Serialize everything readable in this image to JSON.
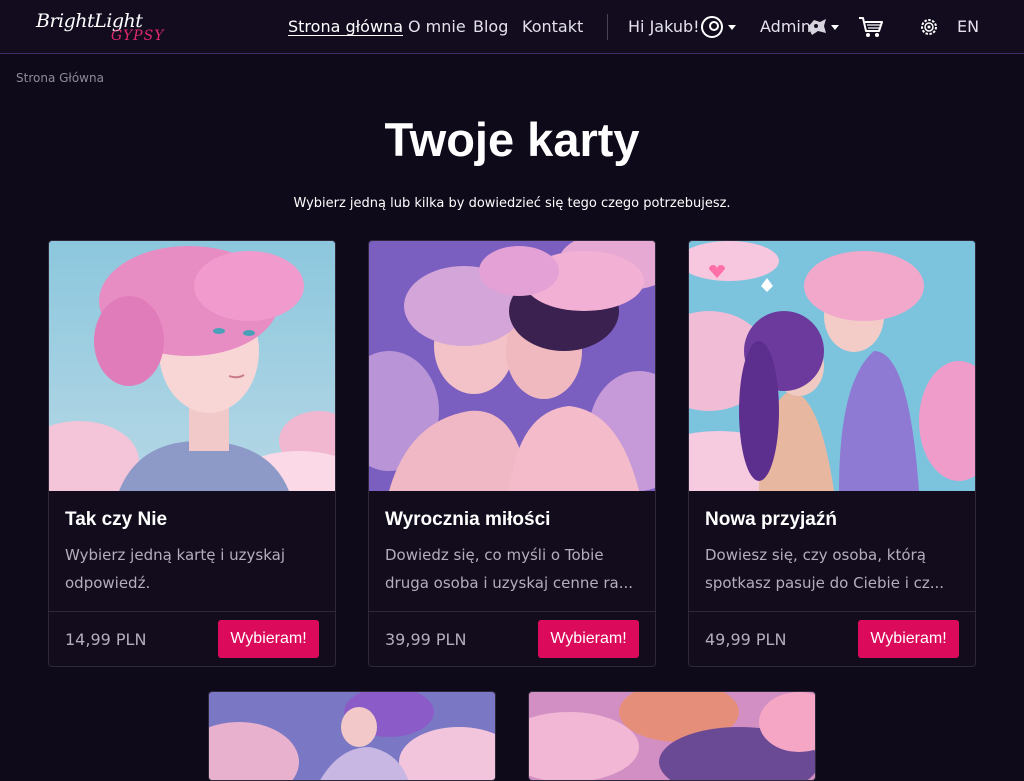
{
  "header": {
    "logo_line1": "BrightLight",
    "logo_line2": "GYPSY",
    "nav": [
      {
        "label": "Strona główna",
        "active": true
      },
      {
        "label": "O mnie"
      },
      {
        "label": "Blog"
      },
      {
        "label": "Kontakt"
      }
    ],
    "greeting": "Hi Jakub!",
    "admin_label": "Admin",
    "language": "EN"
  },
  "breadcrumb": "Strona Główna",
  "page": {
    "title": "Twoje karty",
    "subtitle": "Wybierz jedną lub kilka by dowiedzieć się tego czego potrzebujesz."
  },
  "cards": [
    {
      "title": "Tak czy Nie",
      "description": "Wybierz jedną kartę i uzyskaj odpowiedź.",
      "price": "14,99 PLN",
      "button": "Wybieram!",
      "image": "pink-haired-woman-portrait"
    },
    {
      "title": "Wyrocznia miłości",
      "description": "Dowiedz się, co myśli o Tobie druga osoba i uzyskaj cenne ra...",
      "price": "39,99 PLN",
      "button": "Wybieram!",
      "image": "kissing-couple"
    },
    {
      "title": "Nowa przyjaźń",
      "description": "Dowiesz się, czy osoba, którą spotkasz pasuje do Ciebie i cz...",
      "price": "49,99 PLN",
      "button": "Wybieram!",
      "image": "two-women-friends"
    }
  ],
  "lower_cards": [
    {
      "image": "purple-haired-figure-clouds"
    },
    {
      "image": "pink-purple-clouds"
    }
  ],
  "colors": {
    "background": "#0f0a19",
    "accent": "#dc0a5a",
    "header_border": "#3a2f6a"
  }
}
